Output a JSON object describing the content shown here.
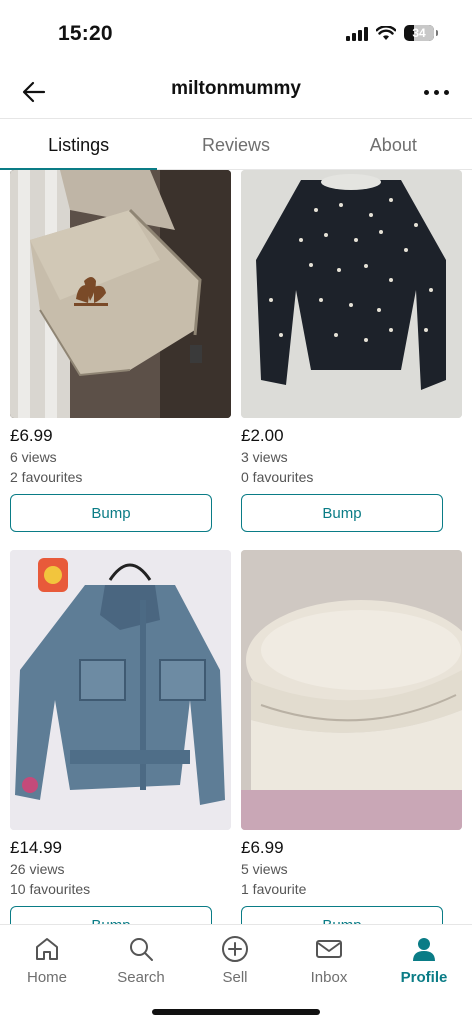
{
  "status_bar": {
    "time": "15:20",
    "battery": "34"
  },
  "header": {
    "title": "miltonmummy"
  },
  "tabs": [
    {
      "label": "Listings",
      "active": true
    },
    {
      "label": "Reviews",
      "active": false
    },
    {
      "label": "About",
      "active": false
    }
  ],
  "listings": [
    {
      "price": "£6.99",
      "views": "6 views",
      "favourites": "2 favourites",
      "bump_label": "Bump",
      "image": "beige bum bag"
    },
    {
      "price": "£2.00",
      "views": "3 views",
      "favourites": "0 favourites",
      "bump_label": "Bump",
      "image": "black pearl jumper"
    },
    {
      "price": "£14.99",
      "views": "26 views",
      "favourites": "10 favourites",
      "bump_label": "Bump",
      "image": "denim jacket"
    },
    {
      "price": "£6.99",
      "views": "5 views",
      "favourites": "1 favourite",
      "bump_label": "Bump",
      "image": "cream baker boy cap"
    }
  ],
  "bottom_nav": [
    {
      "label": "Home",
      "icon": "home-icon",
      "active": false
    },
    {
      "label": "Search",
      "icon": "search-icon",
      "active": false
    },
    {
      "label": "Sell",
      "icon": "plus-circle-icon",
      "active": false
    },
    {
      "label": "Inbox",
      "icon": "mail-icon",
      "active": false
    },
    {
      "label": "Profile",
      "icon": "profile-icon",
      "active": true
    }
  ],
  "colors": {
    "accent": "#0a7c86",
    "muted": "#6f6f6f"
  }
}
